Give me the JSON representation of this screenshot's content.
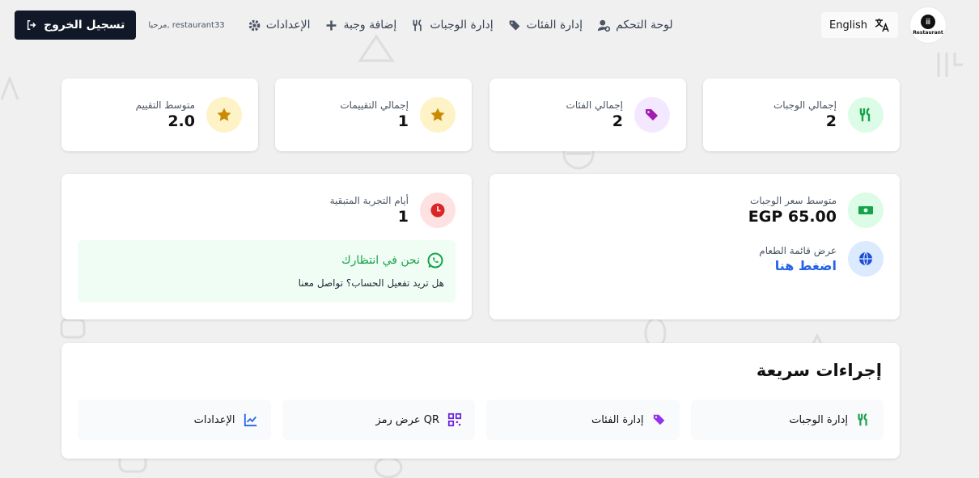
{
  "nav": {
    "logout_label": "تسجيل الخروج",
    "welcome": "مرحبا, restaurant33",
    "links": [
      {
        "label": "الإعدادات",
        "icon": "gear-icon"
      },
      {
        "label": "إضافة وجبة",
        "icon": "plus-icon"
      },
      {
        "label": "إدارة الوجبات",
        "icon": "utensils-icon"
      },
      {
        "label": "إدارة الفئات",
        "icon": "tags-icon"
      },
      {
        "label": "لوحة التحكم",
        "icon": "user-gear-icon"
      }
    ],
    "language_label": "English",
    "logo_text": "Restaurant"
  },
  "stats": [
    {
      "label": "إجمالي الوجبات",
      "value": "2",
      "icon": "utensils-icon",
      "color": "#16a34a"
    },
    {
      "label": "إجمالي الفئات",
      "value": "2",
      "icon": "tags-icon",
      "color": "#a21caf"
    },
    {
      "label": "إجمالي التقييمات",
      "value": "1",
      "icon": "star-icon",
      "color": "#ca8a04"
    },
    {
      "label": "متوسط التقييم",
      "value": "2.0",
      "icon": "star-icon",
      "color": "#ca8a04"
    }
  ],
  "price_card": {
    "avg_price_label": "متوسط سعر الوجبات",
    "avg_price_value": "EGP 65.00",
    "menu_label": "عرض قائمة الطعام",
    "menu_link": "اضغط هنا"
  },
  "trial_card": {
    "days_label": "أيام التجربة المتبقية",
    "days_value": "1",
    "contact_title": "نحن في انتظارك",
    "contact_sub": "هل تريد تفعيل الحساب؟ تواصل معنا"
  },
  "quick_actions": {
    "title": "إجراءات سريعة",
    "items": [
      {
        "label": "إدارة الوجبات",
        "icon": "utensils-icon",
        "color": "#16a34a"
      },
      {
        "label": "إدارة الفئات",
        "icon": "tags-icon",
        "color": "#9333ea"
      },
      {
        "label": "عرض رمز QR",
        "icon": "qrcode-icon",
        "color": "#6d28d9"
      },
      {
        "label": "الإعدادات",
        "icon": "chart-line-icon",
        "color": "#2563eb"
      }
    ]
  }
}
